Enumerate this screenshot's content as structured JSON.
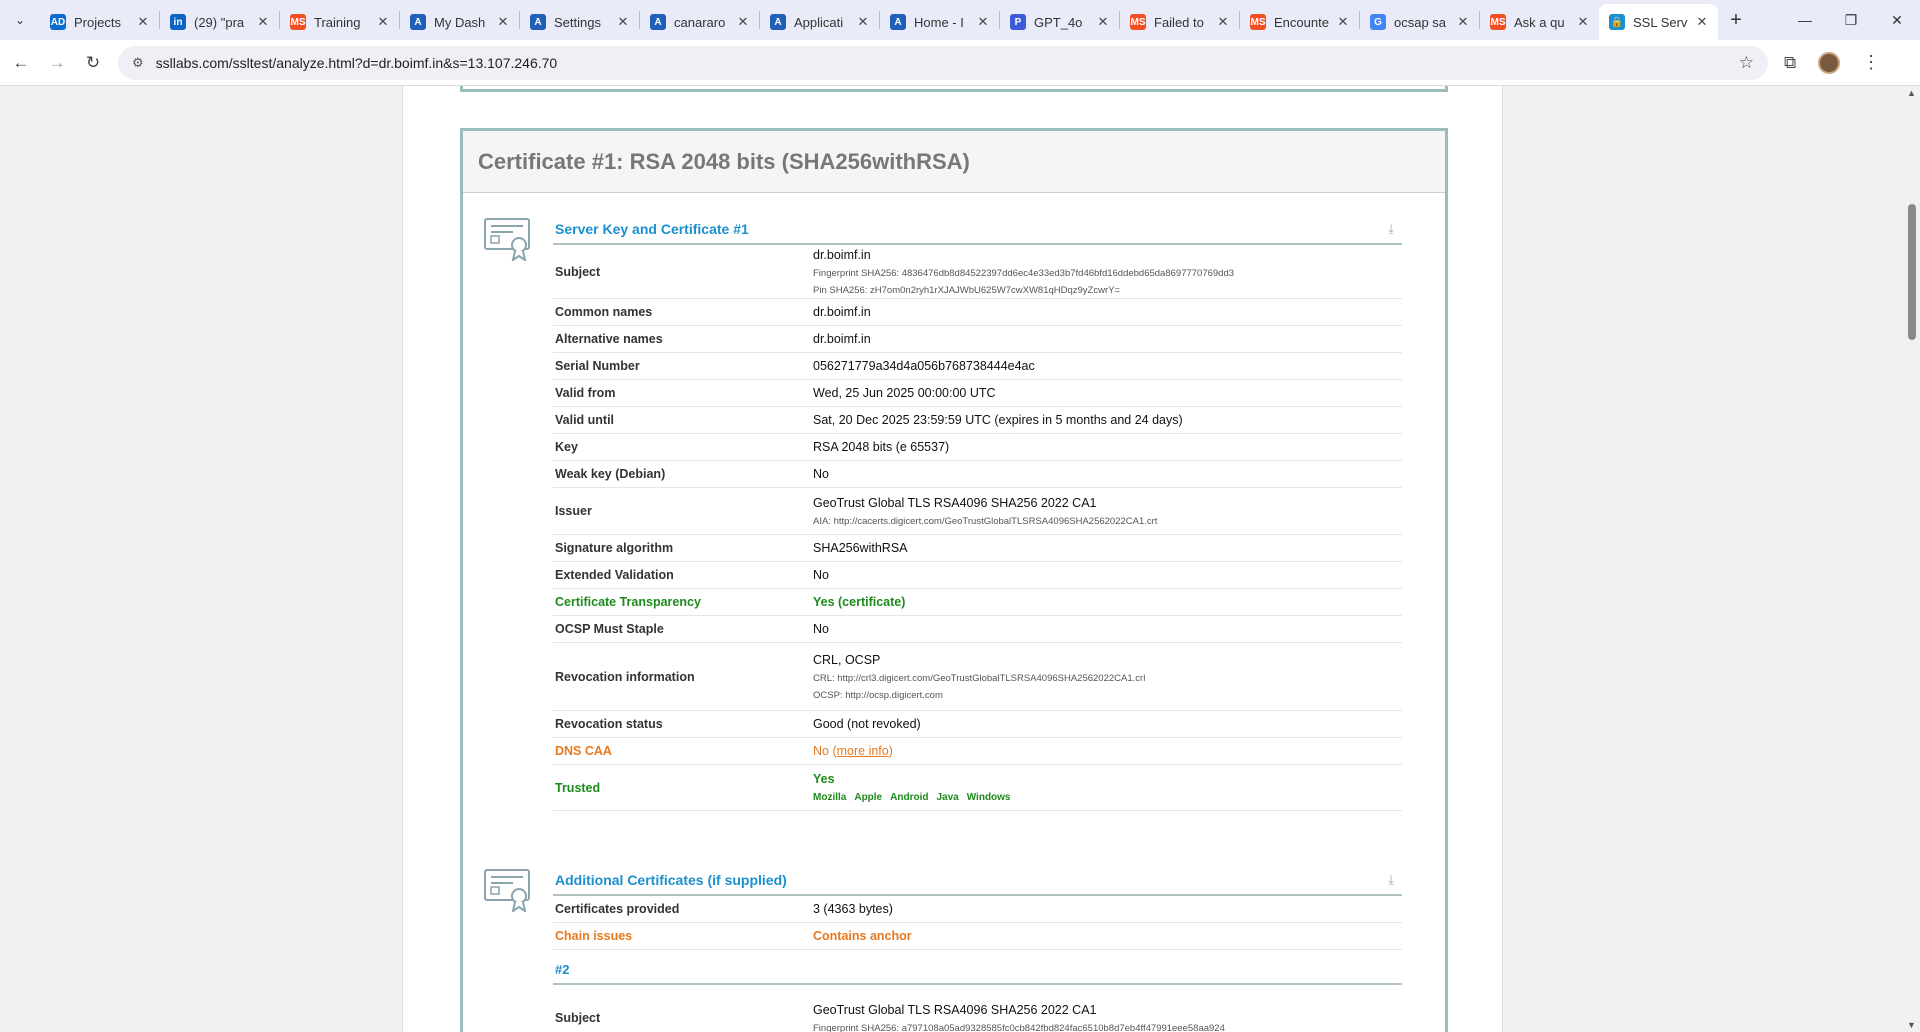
{
  "browser": {
    "tabs": [
      {
        "label": "Projects",
        "fav": "AD",
        "color": "#0b6bcb"
      },
      {
        "label": "(29) \"pra",
        "fav": "in",
        "color": "#0a66c2"
      },
      {
        "label": "Training",
        "fav": "MS",
        "color": "#f25022"
      },
      {
        "label": "My Dash",
        "fav": "A",
        "color": "#1f5fb8"
      },
      {
        "label": "Settings",
        "fav": "A",
        "color": "#1f5fb8"
      },
      {
        "label": "canararo",
        "fav": "A",
        "color": "#1f5fb8"
      },
      {
        "label": "Applicati",
        "fav": "A",
        "color": "#1f5fb8"
      },
      {
        "label": "Home - I",
        "fav": "A",
        "color": "#1f5fb8"
      },
      {
        "label": "GPT_4o",
        "fav": "P",
        "color": "#3b5bdb"
      },
      {
        "label": "Failed to",
        "fav": "MS",
        "color": "#f25022"
      },
      {
        "label": "Encounte",
        "fav": "MS",
        "color": "#f25022"
      },
      {
        "label": "ocsap sa",
        "fav": "G",
        "color": "#4285f4"
      },
      {
        "label": "Ask a qu",
        "fav": "MS",
        "color": "#f25022"
      },
      {
        "label": "SSL Serv",
        "fav": "🔒",
        "color": "#1c8fcf"
      }
    ],
    "url": "ssllabs.com/ssltest/analyze.html?d=dr.boimf.in&s=13.107.246.70"
  },
  "cert": {
    "header": "Certificate #1: RSA 2048 bits (SHA256withRSA)",
    "server_key_title": "Server Key and Certificate #1",
    "rows": {
      "subject": {
        "label": "Subject",
        "value": "dr.boimf.in",
        "fp": "Fingerprint SHA256: 4836476db8d84522397dd6ec4e33ed3b7fd46bfd16ddebd65da8697770769dd3",
        "pin": "Pin SHA256: zH7om0n2ryh1rXJAJWbU625W7cwXW81qHDqz9yZcwrY="
      },
      "common_names": {
        "label": "Common names",
        "value": "dr.boimf.in"
      },
      "alt_names": {
        "label": "Alternative names",
        "value": "dr.boimf.in"
      },
      "serial": {
        "label": "Serial Number",
        "value": "056271779a34d4a056b768738444e4ac"
      },
      "valid_from": {
        "label": "Valid from",
        "value": "Wed, 25 Jun 2025 00:00:00 UTC"
      },
      "valid_until": {
        "label": "Valid until",
        "value": "Sat, 20 Dec 2025 23:59:59 UTC (expires in 5 months and 24 days)"
      },
      "key": {
        "label": "Key",
        "value": "RSA 2048 bits (e 65537)"
      },
      "weak_key": {
        "label": "Weak key (Debian)",
        "value": "No"
      },
      "issuer": {
        "label": "Issuer",
        "value": "GeoTrust Global TLS RSA4096 SHA256 2022 CA1",
        "aia": "AIA: http://cacerts.digicert.com/GeoTrustGlobalTLSRSA4096SHA2562022CA1.crt"
      },
      "sig_alg": {
        "label": "Signature algorithm",
        "value": "SHA256withRSA"
      },
      "ev": {
        "label": "Extended Validation",
        "value": "No"
      },
      "ct": {
        "label": "Certificate Transparency",
        "value": "Yes (certificate)"
      },
      "ocsp_staple": {
        "label": "OCSP Must Staple",
        "value": "No"
      },
      "revocation_info": {
        "label": "Revocation information",
        "value": "CRL, OCSP",
        "crl": "CRL: http://crl3.digicert.com/GeoTrustGlobalTLSRSA4096SHA2562022CA1.crl",
        "ocsp": "OCSP: http://ocsp.digicert.com"
      },
      "revocation_status": {
        "label": "Revocation status",
        "value": "Good (not revoked)"
      },
      "dns_caa": {
        "label": "DNS CAA",
        "value_prefix": "No (",
        "link": "more info",
        "value_suffix": ")"
      },
      "trusted": {
        "label": "Trusted",
        "value": "Yes",
        "platforms": [
          "Mozilla",
          "Apple",
          "Android",
          "Java",
          "Windows"
        ]
      }
    },
    "additional_title": "Additional Certificates (if supplied)",
    "additional": {
      "provided": {
        "label": "Certificates provided",
        "value": "3 (4363 bytes)"
      },
      "chain": {
        "label": "Chain issues",
        "value": "Contains anchor"
      },
      "sub_title": "#2",
      "subject2": {
        "label": "Subject",
        "value": "GeoTrust Global TLS RSA4096 SHA256 2022 CA1",
        "fp": "Fingerprint SHA256: a797108a05ad9328585fc0cb842fbd824fac6510b8d7eb4ff47991eee58aa924"
      }
    }
  }
}
